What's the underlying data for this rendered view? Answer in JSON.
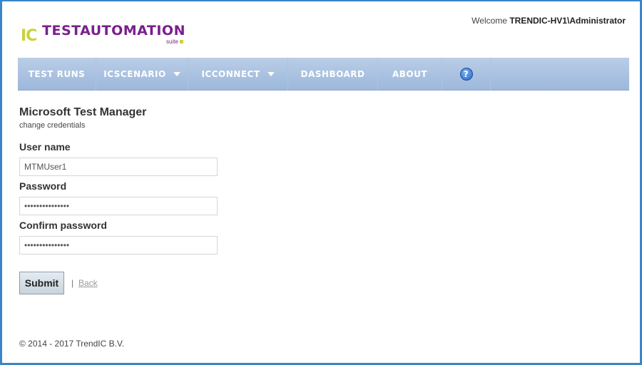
{
  "header": {
    "logo_ic": "IC",
    "logo_word": "TESTAUTOMATION",
    "logo_suite": "suite",
    "welcome_prefix": "Welcome ",
    "welcome_user": "TRENDIC-HV1\\Administrator"
  },
  "nav": {
    "items": [
      {
        "label": "TEST RUNS"
      },
      {
        "label": "ICSCENARIO"
      },
      {
        "label": "ICCONNECT"
      },
      {
        "label": "DASHBOARD"
      },
      {
        "label": "ABOUT"
      }
    ],
    "help_glyph": "?"
  },
  "form": {
    "title": "Microsoft Test Manager",
    "subtitle": "change credentials",
    "username_label": "User name",
    "username_value": "MTMUser1",
    "password_label": "Password",
    "password_value": "•••••••••••••••",
    "confirm_label": "Confirm password",
    "confirm_value": "•••••••••••••••",
    "submit_label": "Submit",
    "separator": "|",
    "back_label": "Back"
  },
  "footer": {
    "copyright": "© 2014 - 2017 TrendIC B.V."
  },
  "colors": {
    "frame": "#3a86c8",
    "nav": "#9db8dc",
    "brand_purple": "#7a1f8c",
    "brand_lime": "#c9d23a"
  }
}
